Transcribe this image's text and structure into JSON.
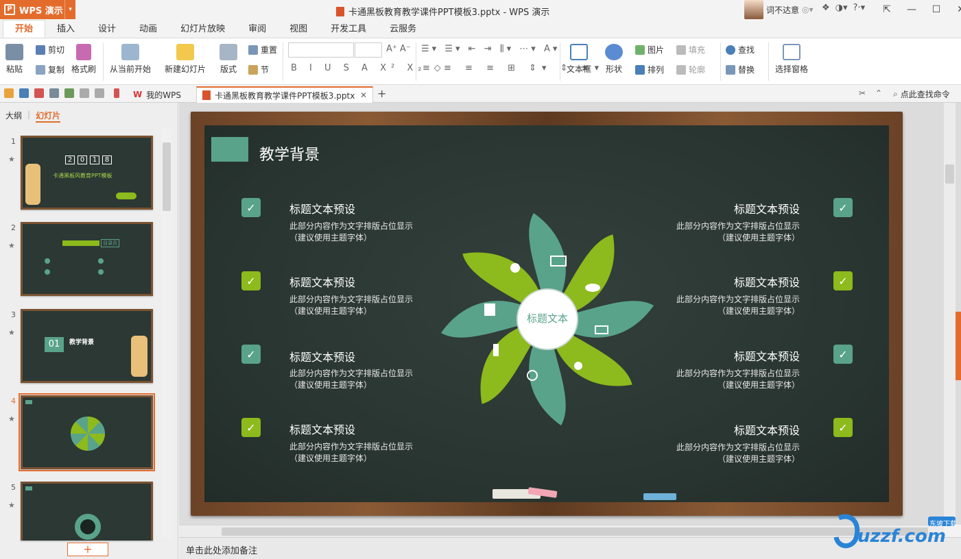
{
  "app": {
    "name": "WPS 演示",
    "logo": "P"
  },
  "window_title": "卡通黑板教育教学课件PPT模板3.pptx - WPS 演示",
  "user": {
    "name": "词不达意"
  },
  "menu_tabs": [
    "开始",
    "插入",
    "设计",
    "动画",
    "幻灯片放映",
    "审阅",
    "视图",
    "开发工具",
    "云服务"
  ],
  "ribbon": {
    "paste": "粘贴",
    "cut": "剪切",
    "copy": "复制",
    "format_painter": "格式刷",
    "play_from_current": "从当前开始",
    "new_slide": "新建幻灯片",
    "layout": "版式",
    "reset": "重置",
    "section": "节",
    "textbox": "文本框",
    "shape": "形状",
    "picture": "图片",
    "arrange": "排列",
    "fill": "填充",
    "outline": "轮廓",
    "find": "查找",
    "replace": "替换",
    "selection_pane": "选择窗格"
  },
  "doc_tabs": {
    "home": "我的WPS",
    "current": "卡通黑板教育教学课件PPT模板3.pptx",
    "search": "点此查找命令"
  },
  "left_panel": {
    "tabs": [
      "大纲",
      "幻灯片"
    ],
    "slides": [
      {
        "num": "1",
        "year_digits": [
          "2",
          "0",
          "1",
          "8"
        ],
        "title": "卡通黑板风教育PPT模板"
      },
      {
        "num": "2",
        "label": "目录页"
      },
      {
        "num": "3",
        "index": "01",
        "title": "教学背景"
      },
      {
        "num": "4"
      },
      {
        "num": "5"
      }
    ],
    "add": "+"
  },
  "slide": {
    "title": "教学背景",
    "center": "标题文本",
    "items": [
      {
        "heading": "标题文本预设",
        "line1": "此部分内容作为文字排版占位显示",
        "line2": "（建议使用主题字体）"
      }
    ],
    "colors": {
      "green": "#8dba1c",
      "teal": "#5aa38b"
    }
  },
  "notes_placeholder": "单击此处添加备注",
  "watermark": {
    "text": "uzzf.com",
    "tag": "东坡下载"
  }
}
